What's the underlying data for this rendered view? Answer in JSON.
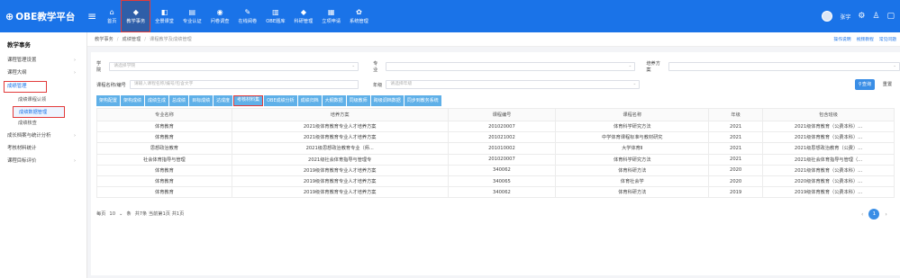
{
  "app": {
    "title": "OBE教学平台",
    "logo_mark": "⊕"
  },
  "nav": [
    {
      "label": "首页",
      "icon": "⌂"
    },
    {
      "label": "教学事务",
      "icon": "◆"
    },
    {
      "label": "全景课堂",
      "icon": "◧"
    },
    {
      "label": "专业认证",
      "icon": "▤"
    },
    {
      "label": "问卷调查",
      "icon": "◉"
    },
    {
      "label": "在线阅卷",
      "icon": "✎"
    },
    {
      "label": "OBE题库",
      "icon": "▥"
    },
    {
      "label": "科研管理",
      "icon": "◆"
    },
    {
      "label": "立项申请",
      "icon": "▦"
    },
    {
      "label": "系统管理",
      "icon": "✿"
    }
  ],
  "top_right": {
    "user": "张宇"
  },
  "sidebar": {
    "title": "教学事务",
    "items": [
      {
        "label": "课程管理设置"
      },
      {
        "label": "课程大纲"
      },
      {
        "label": "成绩管理"
      },
      {
        "label": "成绩课程认领"
      },
      {
        "label": "成绩数据管理"
      },
      {
        "label": "成绩核查"
      },
      {
        "label": "成长档案与统计分析"
      },
      {
        "label": "考核材料统计"
      },
      {
        "label": "课程目标评价"
      }
    ]
  },
  "breadcrumb": [
    "教学事务",
    "成绩管理",
    "课程教学及成绩管理"
  ],
  "help_links": [
    "操作说明",
    "视频教程",
    "常见问题"
  ],
  "filters": {
    "school_label": "学院",
    "school_placeholder": "请选择学院",
    "major_label": "专业",
    "plan_label": "培养方案",
    "course_label": "课程名称/编号",
    "course_placeholder": "请输入课程名称/编号/包含文字",
    "grade_label": "年级",
    "grade_placeholder": "请选择年级",
    "query": "查询",
    "reset": "重置"
  },
  "tabs": [
    "架构配置",
    "架构成绩",
    "成绩生成",
    "总成绩",
    "目标成绩",
    "达成度",
    "考核材料集",
    "OBE成绩分析",
    "成绩归档",
    "大纲数据",
    "同级教师",
    "跨级调档数据",
    "同步到教务系统"
  ],
  "table": {
    "headers": [
      "专业名称",
      "培养方案",
      "课程编号",
      "课程名称",
      "年级",
      "包含班级"
    ],
    "rows": [
      [
        "体育教育",
        "2021级体育教育专业人才培养方案",
        "201020007",
        "体育科学研究方法",
        "2021",
        "2021级体育教育（公费本科）..."
      ],
      [
        "体育教育",
        "2021级体育教育专业人才培养方案",
        "201021002",
        "中学体育课程标准与教材研究",
        "2021",
        "2021级体育教育（公费本科）..."
      ],
      [
        "思想政治教育",
        "2021级思想政治教育专业（师...",
        "201010002",
        "大学体育Ⅱ",
        "2021",
        "2021级思想政治教育（公费）..."
      ],
      [
        "社会体育指导与管理",
        "2021级社会体育指导与管理专",
        "201020007",
        "体育科学研究方法",
        "2021",
        "2021级社会体育指导与管理（..."
      ],
      [
        "体育教育",
        "2019级体育教育专业人才培养方案",
        "340062",
        "体育科研方法",
        "2020",
        "2021级体育教育（公费本科）..."
      ],
      [
        "体育教育",
        "2019级体育教育专业人才培养方案",
        "340065",
        "体育社会学",
        "2020",
        "2020级体育教育（公费本科）..."
      ],
      [
        "体育教育",
        "2019级体育教育专业人才培养方案",
        "340062",
        "体育科研方法",
        "2019",
        "2019级体育教育（公费本科）..."
      ]
    ]
  },
  "pager": {
    "per_page": "每页",
    "size": "10",
    "unit": "条",
    "summary": "共7条 当前第1页 共1页",
    "current": "1"
  }
}
